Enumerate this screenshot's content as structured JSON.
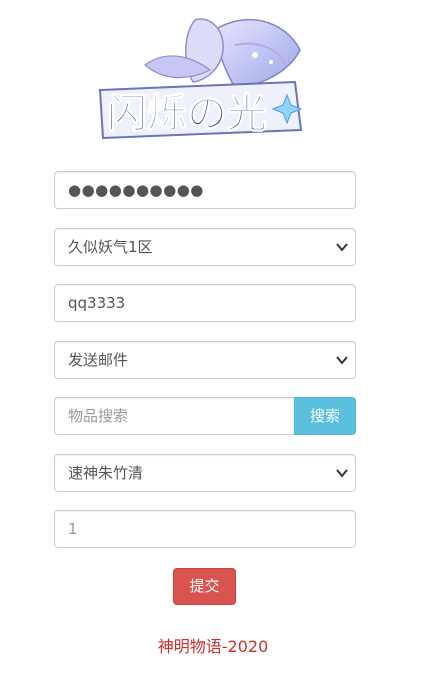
{
  "logo": {
    "text": "闪烁の光"
  },
  "password": {
    "value": "●●●●●●●●●●"
  },
  "server_select": {
    "selected": "久似妖气1区"
  },
  "account_input": {
    "value": "qq3333"
  },
  "action_select": {
    "selected": "发送邮件"
  },
  "item_search": {
    "placeholder": "物品搜索",
    "button_label": "搜索"
  },
  "item_select": {
    "selected": "速神朱竹清"
  },
  "quantity_input": {
    "placeholder": "1"
  },
  "submit_label": "提交",
  "footer": {
    "text": "神明物语-2020"
  },
  "colors": {
    "search_button": "#5bc0de",
    "submit_button": "#d9534f",
    "footer_text": "#c9302c"
  },
  "icons": [
    "chevron-down-icon"
  ]
}
